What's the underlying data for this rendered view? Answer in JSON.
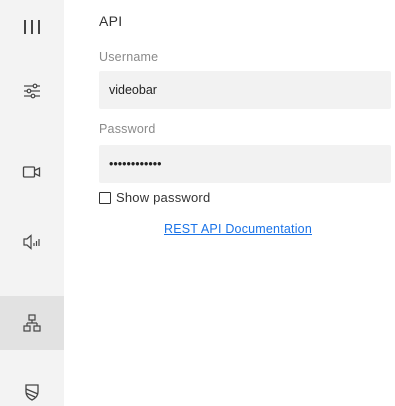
{
  "sidebar": {
    "items": [
      {
        "icon": "menu-icon"
      },
      {
        "icon": "sliders-icon"
      },
      {
        "icon": "camera-icon"
      },
      {
        "icon": "speaker-icon"
      },
      {
        "icon": "network-icon",
        "active": true
      },
      {
        "icon": "shield-icon"
      }
    ]
  },
  "main": {
    "title": "API",
    "username": {
      "label": "Username",
      "value": "videobar"
    },
    "password": {
      "label": "Password",
      "value": "••••••••••••"
    },
    "show_password": {
      "label": "Show password",
      "checked": false
    },
    "doc_link": "REST API Documentation"
  },
  "colors": {
    "sidebar_bg": "#f3f3f3",
    "active_item_bg": "#e2e2e2",
    "input_bg": "#f2f2f2",
    "link": "#1a73e8"
  }
}
